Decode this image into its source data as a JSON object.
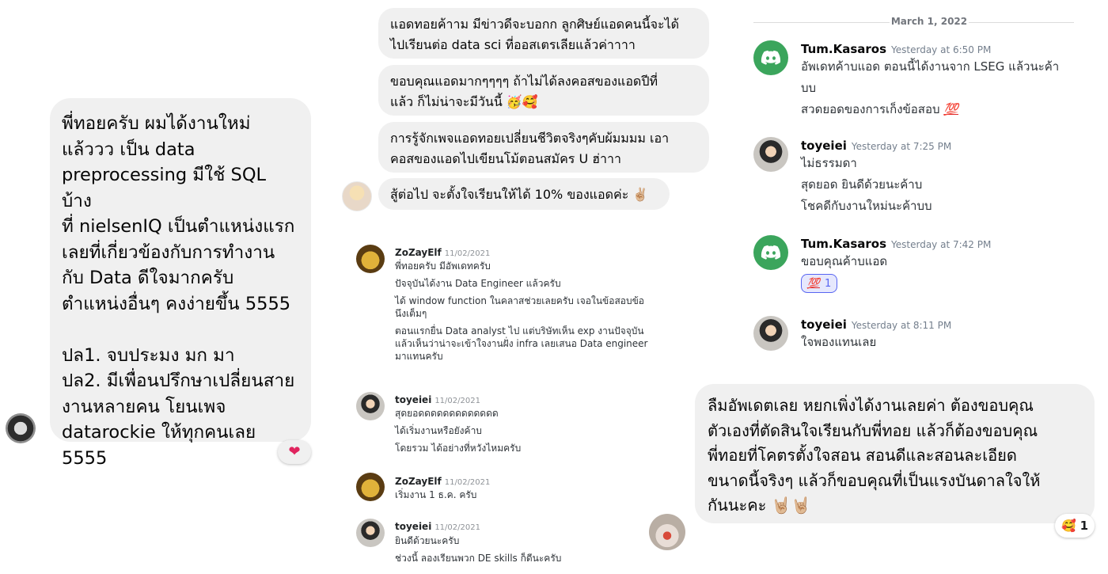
{
  "left_chat": {
    "message": "พี่ทอยครับ ผมได้งานใหม่\nแล้ววว  เป็น data\npreprocessing มีใช้ SQL บ้าง\nที่ nielsenIQ  เป็นตำแหน่งแรก\nเลยที่เกี่ยวข้องกับการทำงาน\nกับ Data   ดีใจมากครับ\nตำแหน่งอื่นๆ คงง่ายขึ้น 5555\n\nปล1. จบประมง มก มา\nปล2. มีเพื่อนปรึกษาเปลี่ยนสาย\nงานหลายคน  โยนเพจ\ndatarockie ให้ทุกคนเลย\n5555",
    "reaction": "❤"
  },
  "mid_chat": {
    "bubbles": [
      "แอดทอยค้าาม มีข่าวดีจะบอกก ลูกศิษย์แอดคนนี้จะได้\nไปเรียนต่อ data sci ที่ออสเตรเลียแล้วค่าาาา",
      "ขอบคุณแอดมากๆๆๆๆ ถ้าไม่ได้ลงคอสของแอดปีที่\nแล้ว ก็ไม่น่าจะมีวันนี้ 🥳🥰",
      "การรู้จักเพจแอดทอยเปลี่ยนชีวิตจริงๆคับผ้มมมม เอา\nคอสของแอดไปเขียนโม้ตอนสมัคร U ฮ่าาา",
      "สู้ต่อไป จะตั้งใจเรียนให้ได้ 10% ของแอดค่ะ ✌🏼"
    ]
  },
  "discord_mid": {
    "messages": [
      {
        "author": "ZoZayElf",
        "time": "11/02/2021",
        "lines": [
          "พี่ทอยครับ มีอัพเดทครับ",
          "ปัจจุบันได้งาน Data Engineer แล้วครับ",
          "ได้ window function ในคลาสช่วยเลยครับ เจอในข้อสอบข้อ",
          "นึงเต็มๆ",
          "ตอนแรกยื่น Data analyst ไป แต่บริษัทเห็น exp งานปัจจุบัน",
          "แล้วเห็นว่าน่าจะเข้าใจงานฝั่ง infra เลยเสนอ Data engineer",
          "มาแทนครับ"
        ]
      },
      {
        "author": "toyeiei",
        "time": "11/02/2021",
        "lines": [
          "สุดยอดดดดดดดดดดดดด",
          "ได้เริ่มงานหรือยังค้าบ",
          "โดยรวม ได้อย่างที่หวังไหมครับ"
        ]
      },
      {
        "author": "ZoZayElf",
        "time": "11/02/2021",
        "lines": [
          "เริ่มงาน 1 ธ.ค. ครับ"
        ]
      },
      {
        "author": "toyeiei",
        "time": "11/02/2021",
        "lines": [
          "ยินดีด้วยนะครับ",
          "ช่วงนี้ ลองเรียนพวก DE skills ก็ดีนะครับ"
        ]
      }
    ]
  },
  "discord_right": {
    "date": "March 1, 2022",
    "messages": [
      {
        "author": "Tum.Kasaros",
        "time": "Yesterday at 6:50 PM",
        "lines": [
          "อัพเดทค้าบแอด ตอนนี้ได้งานจาก LSEG แล้วนะค้า",
          "บบ",
          "สวดยอดของการเก็งข้อสอบ"
        ],
        "emoji": "💯"
      },
      {
        "author": "toyeiei",
        "time": "Yesterday at 7:25 PM",
        "lines": [
          "ไม่ธรรมดา",
          "สุดยอด ยินดีด้วยนะค้าบ",
          "โชคดีกับงานใหม่นะค้าบบ"
        ]
      },
      {
        "author": "Tum.Kasaros",
        "time": "Yesterday at 7:42 PM",
        "lines": [
          "ขอบคุณค้าบแอด"
        ],
        "reaction": {
          "emoji": "💯",
          "count": "1"
        }
      },
      {
        "author": "toyeiei",
        "time": "Yesterday at 8:11 PM",
        "lines": [
          "ใจพองแทนเลย"
        ]
      }
    ]
  },
  "right_chat": {
    "message": "ลืมอัพเดตเลย หยกเพิ่งได้งานเลยค่า ต้องขอบคุณ\nตัวเองที่ตัดสินใจเรียนกับพี่ทอย แล้วก็ต้องขอบคุณ\nพี่ทอยที่โคตรตั้งใจสอน สอนดีและสอนละเอียด\nขนาดนี้จริงๆ แล้วก็ขอบคุณที่เป็นแรงบันดาลใจให้\nกันนะคะ 🤘🏼🤘🏼",
    "reaction": {
      "emoji": "🥰",
      "count": "1"
    }
  },
  "colors": {
    "bubble": "#f0f0f0",
    "discord_green": "#3ba55c",
    "reaction_blue": "#5865f2"
  }
}
